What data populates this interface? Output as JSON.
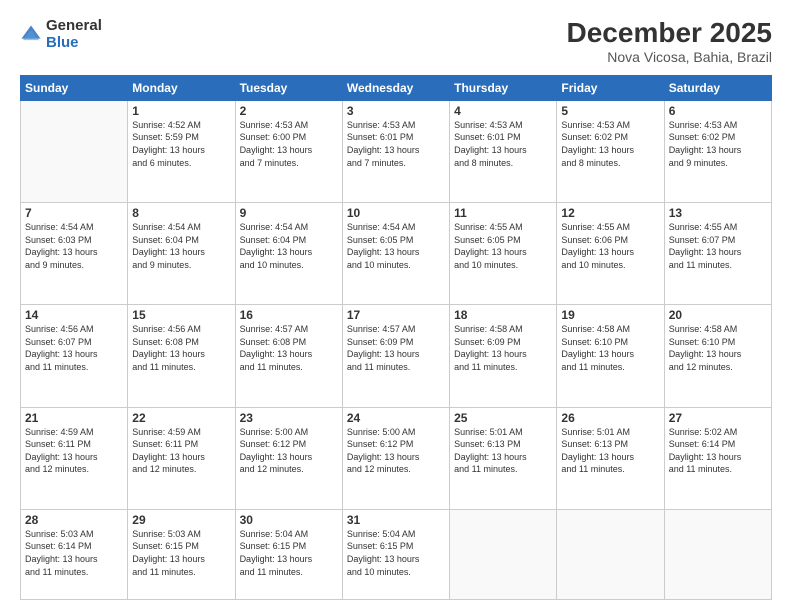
{
  "logo": {
    "general": "General",
    "blue": "Blue"
  },
  "header": {
    "month": "December 2025",
    "location": "Nova Vicosa, Bahia, Brazil"
  },
  "days_of_week": [
    "Sunday",
    "Monday",
    "Tuesday",
    "Wednesday",
    "Thursday",
    "Friday",
    "Saturday"
  ],
  "weeks": [
    [
      {
        "day": "",
        "info": ""
      },
      {
        "day": "1",
        "info": "Sunrise: 4:52 AM\nSunset: 5:59 PM\nDaylight: 13 hours\nand 6 minutes."
      },
      {
        "day": "2",
        "info": "Sunrise: 4:53 AM\nSunset: 6:00 PM\nDaylight: 13 hours\nand 7 minutes."
      },
      {
        "day": "3",
        "info": "Sunrise: 4:53 AM\nSunset: 6:01 PM\nDaylight: 13 hours\nand 7 minutes."
      },
      {
        "day": "4",
        "info": "Sunrise: 4:53 AM\nSunset: 6:01 PM\nDaylight: 13 hours\nand 8 minutes."
      },
      {
        "day": "5",
        "info": "Sunrise: 4:53 AM\nSunset: 6:02 PM\nDaylight: 13 hours\nand 8 minutes."
      },
      {
        "day": "6",
        "info": "Sunrise: 4:53 AM\nSunset: 6:02 PM\nDaylight: 13 hours\nand 9 minutes."
      }
    ],
    [
      {
        "day": "7",
        "info": "Sunrise: 4:54 AM\nSunset: 6:03 PM\nDaylight: 13 hours\nand 9 minutes."
      },
      {
        "day": "8",
        "info": "Sunrise: 4:54 AM\nSunset: 6:04 PM\nDaylight: 13 hours\nand 9 minutes."
      },
      {
        "day": "9",
        "info": "Sunrise: 4:54 AM\nSunset: 6:04 PM\nDaylight: 13 hours\nand 10 minutes."
      },
      {
        "day": "10",
        "info": "Sunrise: 4:54 AM\nSunset: 6:05 PM\nDaylight: 13 hours\nand 10 minutes."
      },
      {
        "day": "11",
        "info": "Sunrise: 4:55 AM\nSunset: 6:05 PM\nDaylight: 13 hours\nand 10 minutes."
      },
      {
        "day": "12",
        "info": "Sunrise: 4:55 AM\nSunset: 6:06 PM\nDaylight: 13 hours\nand 10 minutes."
      },
      {
        "day": "13",
        "info": "Sunrise: 4:55 AM\nSunset: 6:07 PM\nDaylight: 13 hours\nand 11 minutes."
      }
    ],
    [
      {
        "day": "14",
        "info": "Sunrise: 4:56 AM\nSunset: 6:07 PM\nDaylight: 13 hours\nand 11 minutes."
      },
      {
        "day": "15",
        "info": "Sunrise: 4:56 AM\nSunset: 6:08 PM\nDaylight: 13 hours\nand 11 minutes."
      },
      {
        "day": "16",
        "info": "Sunrise: 4:57 AM\nSunset: 6:08 PM\nDaylight: 13 hours\nand 11 minutes."
      },
      {
        "day": "17",
        "info": "Sunrise: 4:57 AM\nSunset: 6:09 PM\nDaylight: 13 hours\nand 11 minutes."
      },
      {
        "day": "18",
        "info": "Sunrise: 4:58 AM\nSunset: 6:09 PM\nDaylight: 13 hours\nand 11 minutes."
      },
      {
        "day": "19",
        "info": "Sunrise: 4:58 AM\nSunset: 6:10 PM\nDaylight: 13 hours\nand 11 minutes."
      },
      {
        "day": "20",
        "info": "Sunrise: 4:58 AM\nSunset: 6:10 PM\nDaylight: 13 hours\nand 12 minutes."
      }
    ],
    [
      {
        "day": "21",
        "info": "Sunrise: 4:59 AM\nSunset: 6:11 PM\nDaylight: 13 hours\nand 12 minutes."
      },
      {
        "day": "22",
        "info": "Sunrise: 4:59 AM\nSunset: 6:11 PM\nDaylight: 13 hours\nand 12 minutes."
      },
      {
        "day": "23",
        "info": "Sunrise: 5:00 AM\nSunset: 6:12 PM\nDaylight: 13 hours\nand 12 minutes."
      },
      {
        "day": "24",
        "info": "Sunrise: 5:00 AM\nSunset: 6:12 PM\nDaylight: 13 hours\nand 12 minutes."
      },
      {
        "day": "25",
        "info": "Sunrise: 5:01 AM\nSunset: 6:13 PM\nDaylight: 13 hours\nand 11 minutes."
      },
      {
        "day": "26",
        "info": "Sunrise: 5:01 AM\nSunset: 6:13 PM\nDaylight: 13 hours\nand 11 minutes."
      },
      {
        "day": "27",
        "info": "Sunrise: 5:02 AM\nSunset: 6:14 PM\nDaylight: 13 hours\nand 11 minutes."
      }
    ],
    [
      {
        "day": "28",
        "info": "Sunrise: 5:03 AM\nSunset: 6:14 PM\nDaylight: 13 hours\nand 11 minutes."
      },
      {
        "day": "29",
        "info": "Sunrise: 5:03 AM\nSunset: 6:15 PM\nDaylight: 13 hours\nand 11 minutes."
      },
      {
        "day": "30",
        "info": "Sunrise: 5:04 AM\nSunset: 6:15 PM\nDaylight: 13 hours\nand 11 minutes."
      },
      {
        "day": "31",
        "info": "Sunrise: 5:04 AM\nSunset: 6:15 PM\nDaylight: 13 hours\nand 10 minutes."
      },
      {
        "day": "",
        "info": ""
      },
      {
        "day": "",
        "info": ""
      },
      {
        "day": "",
        "info": ""
      }
    ]
  ]
}
